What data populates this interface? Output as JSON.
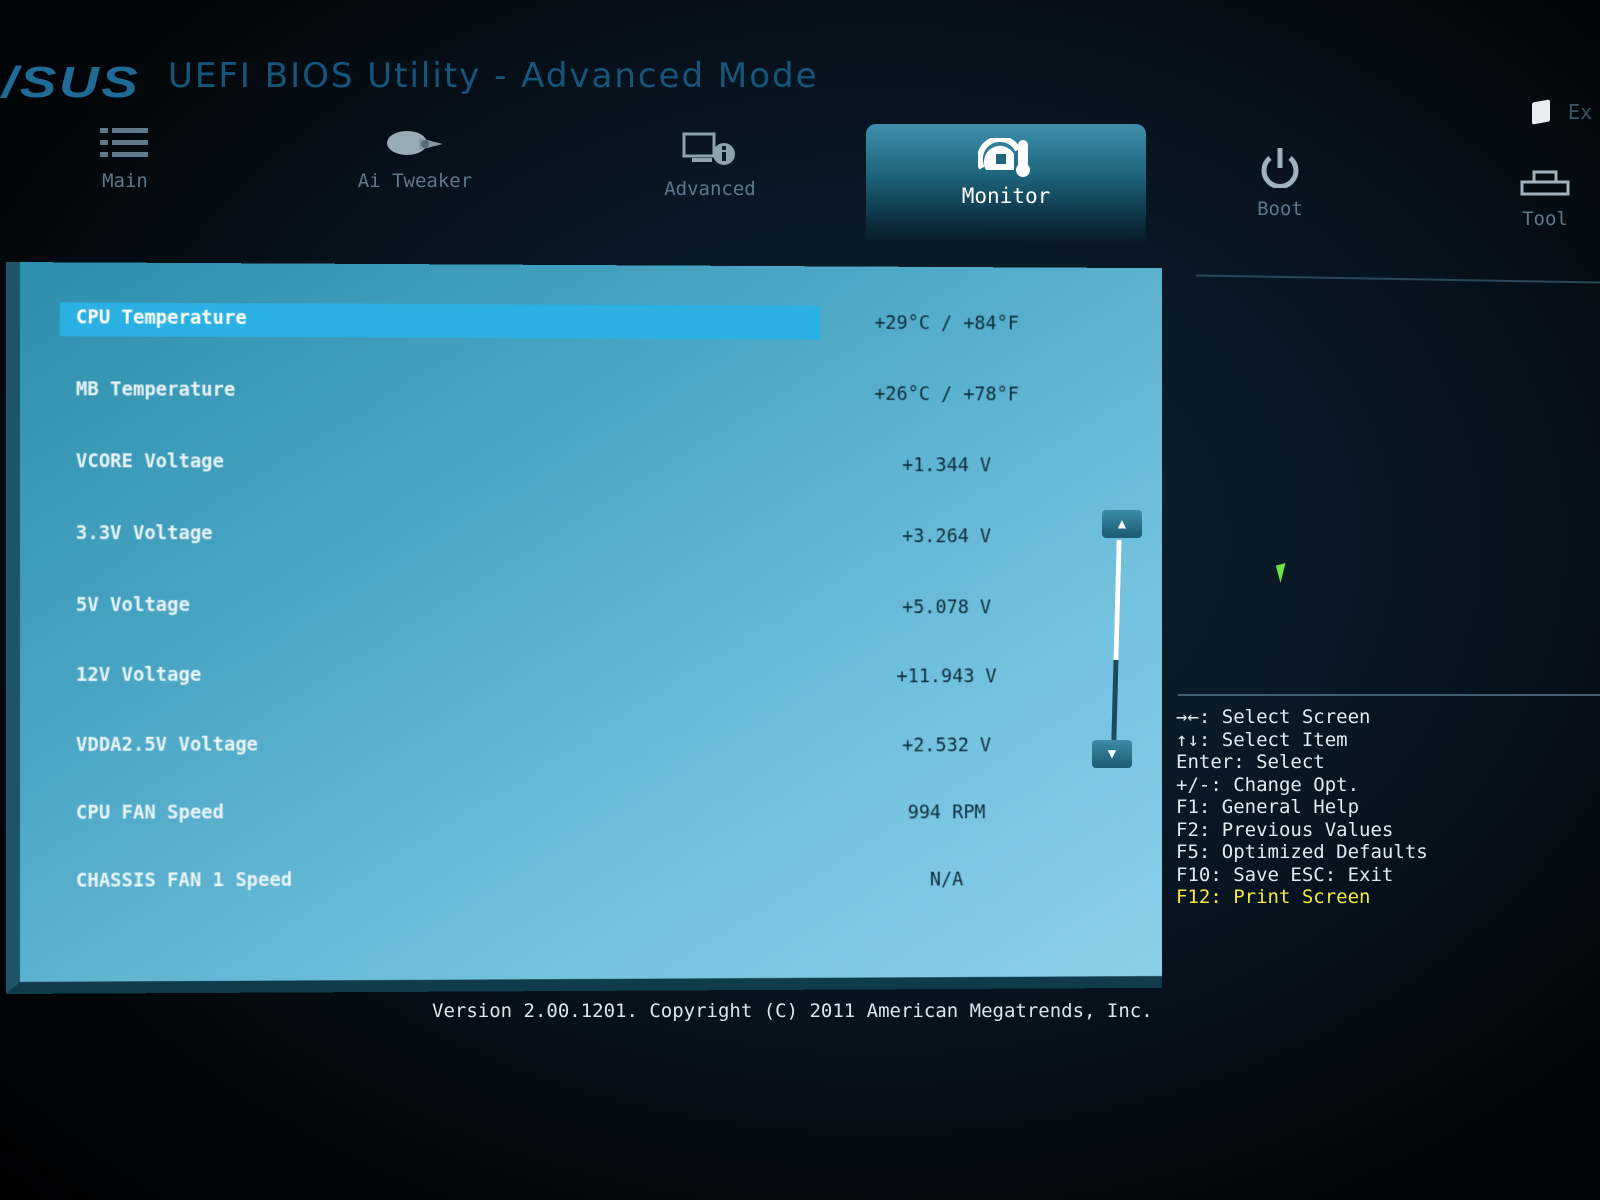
{
  "window": {
    "logo": "/SUS",
    "title": "UEFI BIOS Utility - Advanced Mode",
    "exit_label": "Ex"
  },
  "tabs": [
    {
      "label": "Main",
      "icon": "list-icon",
      "active": false
    },
    {
      "label": "Ai Tweaker",
      "icon": "tweaker-icon",
      "active": false
    },
    {
      "label": "Advanced",
      "icon": "advanced-info-icon",
      "active": false
    },
    {
      "label": "Monitor",
      "icon": "thermometer-gauge-icon",
      "active": true
    },
    {
      "label": "Boot",
      "icon": "power-icon",
      "active": false
    },
    {
      "label": "Tool",
      "icon": "tool-icon",
      "active": false
    }
  ],
  "monitor": {
    "items": [
      {
        "label": "CPU Temperature",
        "value": "+29°C / +84°F",
        "selected": true
      },
      {
        "label": "MB Temperature",
        "value": "+26°C / +78°F"
      },
      {
        "label": "VCORE Voltage",
        "value": "+1.344 V"
      },
      {
        "label": "3.3V Voltage",
        "value": "+3.264 V"
      },
      {
        "label": "5V Voltage",
        "value": "+5.078 V"
      },
      {
        "label": "12V Voltage",
        "value": "+11.943 V"
      },
      {
        "label": "VDDA2.5V Voltage",
        "value": "+2.532 V"
      },
      {
        "label": "CPU FAN Speed",
        "value": "994 RPM"
      },
      {
        "label": "CHASSIS FAN 1 Speed",
        "value": "N/A"
      }
    ]
  },
  "help": {
    "lines": [
      "→←: Select Screen",
      "↑↓: Select Item",
      "Enter: Select",
      "+/-: Change Opt.",
      "F1: General Help",
      "F2: Previous Values",
      "F5: Optimized Defaults",
      "F10: Save  ESC: Exit"
    ],
    "highlight": "F12: Print Screen"
  },
  "footer": {
    "version": "Version 2.00.1201. Copyright (C) 2011 American Megatrends, Inc."
  },
  "colors": {
    "panel": "#4aa6c4",
    "selected_bar": "#2bb0e3",
    "highlight_text": "#f4ea3c",
    "title": "#16567a"
  }
}
